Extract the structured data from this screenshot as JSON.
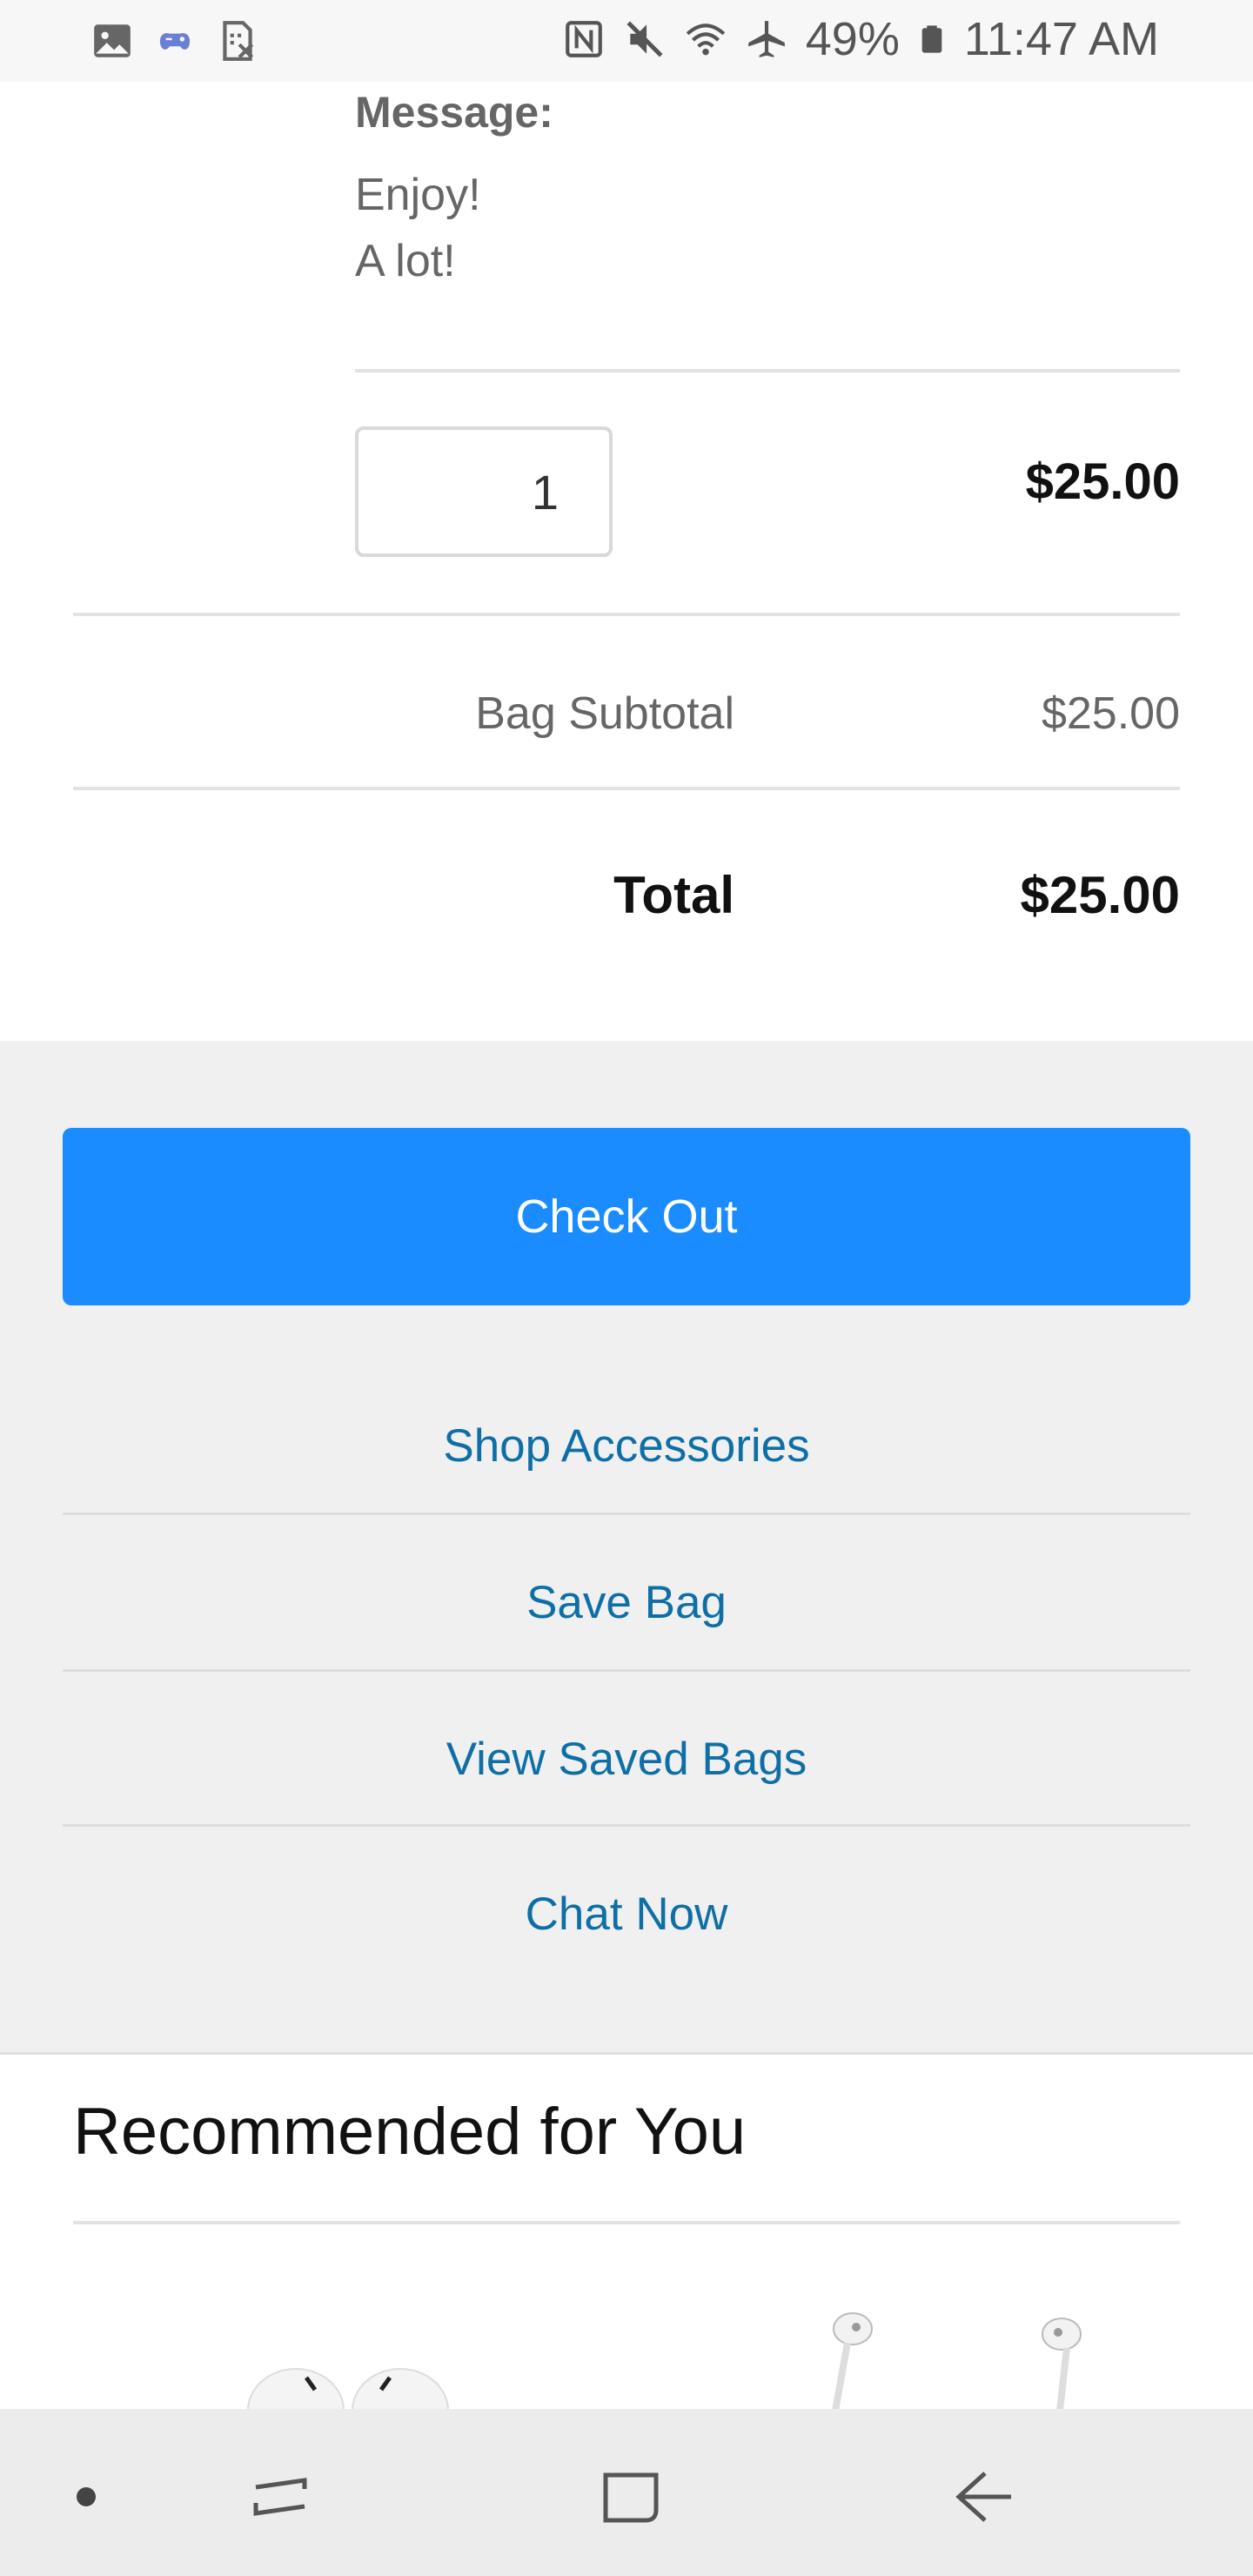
{
  "status_bar": {
    "battery": "49%",
    "time": "11:47 AM",
    "left_icons": [
      "image-icon",
      "game-controller-icon",
      "sim-off-icon"
    ],
    "right_icons": [
      "nfc-icon",
      "mute-icon",
      "wifi-icon",
      "airplane-icon",
      "battery-icon"
    ]
  },
  "item": {
    "message_label": "Message:",
    "message_lines": [
      "Enjoy!",
      "A lot!"
    ],
    "quantity": "1",
    "price": "$25.00"
  },
  "summary": {
    "subtotal_label": "Bag Subtotal",
    "subtotal_value": "$25.00",
    "total_label": "Total",
    "total_value": "$25.00"
  },
  "actions": {
    "checkout": "Check Out",
    "links": [
      "Shop Accessories",
      "Save Bag",
      "View Saved Bags",
      "Chat Now"
    ]
  },
  "recommended": {
    "title": "Recommended for You",
    "products": [
      "airpods-image",
      "earpods-image"
    ]
  },
  "nav_bar": {
    "buttons": [
      "dot-icon",
      "recents-icon",
      "home-icon",
      "back-icon"
    ]
  },
  "colors": {
    "accent": "#1a8cff",
    "link": "#0e6fa6",
    "panel": "#f0f0f0"
  }
}
